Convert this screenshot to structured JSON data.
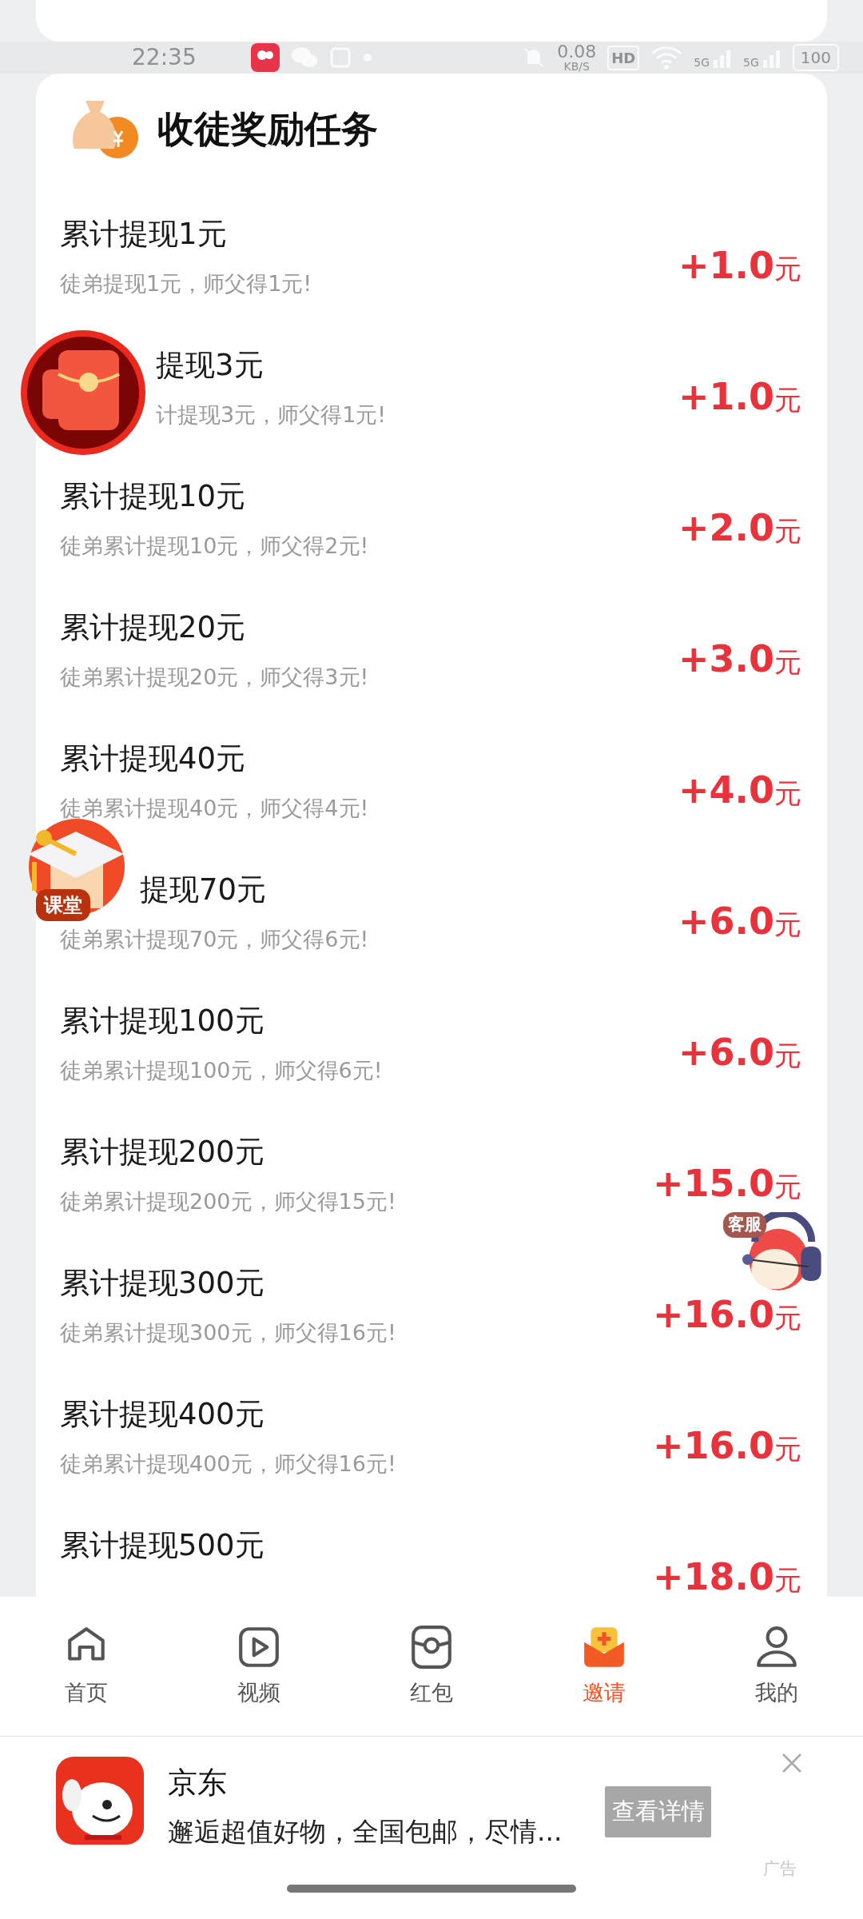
{
  "status_bar": {
    "time": "22:35",
    "net_speed": "0.08",
    "net_speed_unit": "KB/S",
    "hd": "HD",
    "signal_labels": [
      "5G",
      "5G"
    ],
    "battery": "100"
  },
  "section": {
    "title": "收徒奖励任务"
  },
  "tasks": [
    {
      "kind": "full",
      "title": "累计提现1元",
      "subtitle": "徒弟提现1元，师父得1元!",
      "amount": "+1.0",
      "unit": "元"
    },
    {
      "kind": "covered",
      "title": "提现3元",
      "subtitle": "计提现3元，师父得1元!",
      "amount": "+1.0",
      "unit": "元"
    },
    {
      "kind": "full",
      "title": "累计提现10元",
      "subtitle": "徒弟累计提现10元，师父得2元!",
      "amount": "+2.0",
      "unit": "元"
    },
    {
      "kind": "full",
      "title": "累计提现20元",
      "subtitle": "徒弟累计提现20元，师父得3元!",
      "amount": "+3.0",
      "unit": "元"
    },
    {
      "kind": "full",
      "title": "累计提现40元",
      "subtitle": "徒弟累计提现40元，师父得4元!",
      "amount": "+4.0",
      "unit": "元"
    },
    {
      "kind": "title_covered",
      "title": "提现70元",
      "subtitle": "徒弟累计提现70元，师父得6元!",
      "amount": "+6.0",
      "unit": "元"
    },
    {
      "kind": "full",
      "title": "累计提现100元",
      "subtitle": "徒弟累计提现100元，师父得6元!",
      "amount": "+6.0",
      "unit": "元"
    },
    {
      "kind": "full",
      "title": "累计提现200元",
      "subtitle": "徒弟累计提现200元，师父得15元!",
      "amount": "+15.0",
      "unit": "元"
    },
    {
      "kind": "full",
      "title": "累计提现300元",
      "subtitle": "徒弟累计提现300元，师父得16元!",
      "amount": "+16.0",
      "unit": "元"
    },
    {
      "kind": "full",
      "title": "累计提现400元",
      "subtitle": "徒弟累计提现400元，师父得16元!",
      "amount": "+16.0",
      "unit": "元"
    },
    {
      "kind": "full",
      "title": "累计提现500元",
      "amount": "+18.0",
      "unit": "元"
    }
  ],
  "floating_buttons": [
    {
      "kind": "red_envelope"
    },
    {
      "kind": "classroom",
      "label": "课堂"
    },
    {
      "kind": "service",
      "label": "客服"
    }
  ],
  "nav": [
    {
      "kind": "home",
      "label": "首页",
      "selected": false
    },
    {
      "kind": "video",
      "label": "视频",
      "selected": false
    },
    {
      "kind": "redpacket",
      "label": "红包",
      "selected": false
    },
    {
      "kind": "invite",
      "label": "邀请",
      "selected": true
    },
    {
      "kind": "me",
      "label": "我的",
      "selected": false
    }
  ],
  "ad": {
    "brand": "京东",
    "text": "邂逅超值好物，全国包邮，尽情...",
    "button": "查看详情",
    "tag": "广告"
  }
}
